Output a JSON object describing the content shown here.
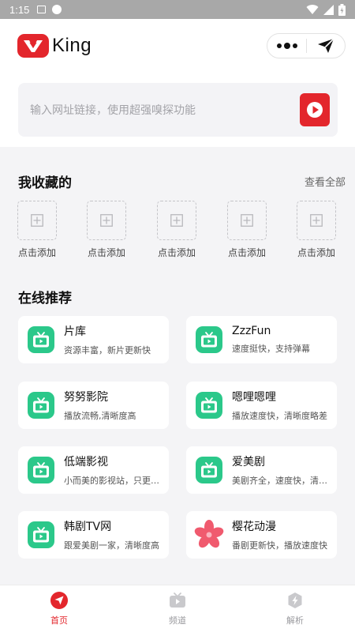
{
  "status_bar": {
    "time": "1:15"
  },
  "app": {
    "logo_text": "King",
    "brand_color": "#e3262c",
    "accent_green": "#2bc88a"
  },
  "search": {
    "placeholder": "输入网址链接，使用超强嗅探功能"
  },
  "favorites": {
    "title": "我收藏的",
    "see_all": "查看全部",
    "items": [
      {
        "label": "点击添加"
      },
      {
        "label": "点击添加"
      },
      {
        "label": "点击添加"
      },
      {
        "label": "点击添加"
      },
      {
        "label": "点击添加"
      }
    ]
  },
  "recommend": {
    "title": "在线推荐",
    "items": [
      {
        "name": "片库",
        "desc": "资源丰富，新片更新快",
        "icon": "tv-icon"
      },
      {
        "name": "ZzzFun",
        "desc": "速度挺快，支持弹幕",
        "icon": "tv-icon"
      },
      {
        "name": "努努影院",
        "desc": "播放流畅,清晰度高",
        "icon": "tv-icon"
      },
      {
        "name": "嗯哩嗯哩",
        "desc": "播放速度快，清晰度略差",
        "icon": "tv-icon"
      },
      {
        "name": "低端影视",
        "desc": "小而美的影视站，只更新精品",
        "icon": "tv-icon"
      },
      {
        "name": "爱美剧",
        "desc": "美剧齐全，速度快，清晰度高",
        "icon": "tv-icon"
      },
      {
        "name": "韩剧TV网",
        "desc": "跟爱美剧一家，清晰度高",
        "icon": "tv-icon"
      },
      {
        "name": "樱花动漫",
        "desc": "番剧更新快，播放速度快",
        "icon": "sakura-icon"
      }
    ]
  },
  "tabs": [
    {
      "label": "首页",
      "active": true,
      "icon": "paper-plane-icon"
    },
    {
      "label": "频道",
      "active": false,
      "icon": "tv-icon"
    },
    {
      "label": "解析",
      "active": false,
      "icon": "lightning-shield-icon"
    }
  ]
}
